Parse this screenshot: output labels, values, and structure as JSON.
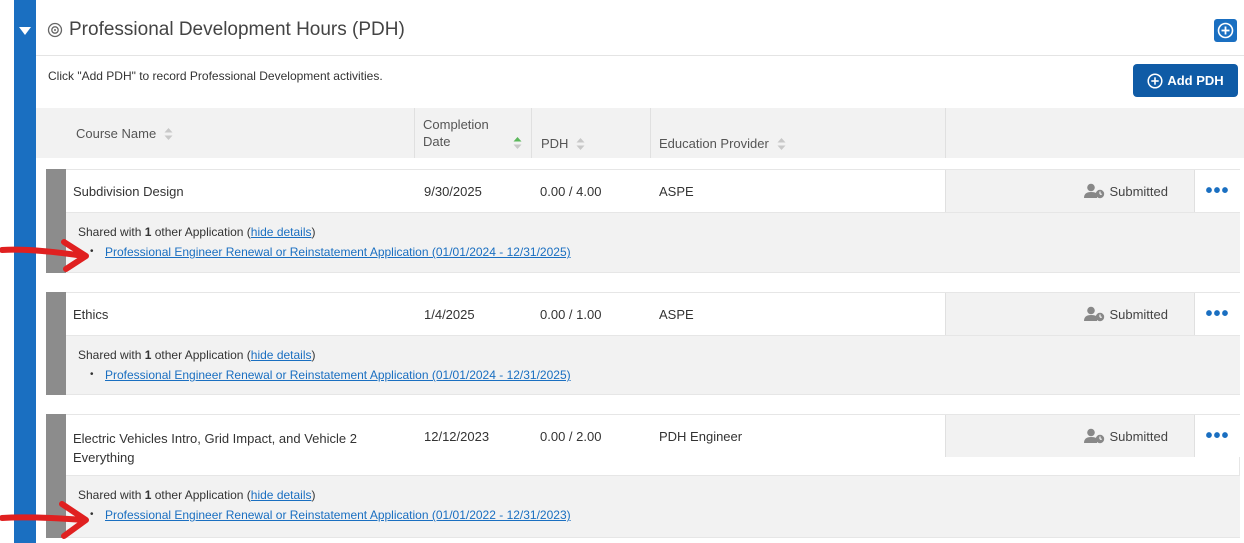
{
  "section": {
    "title": "Professional Development Hours (PDH)",
    "instructions": "Click \"Add PDH\" to record Professional Development activities.",
    "add_button_label": "Add PDH"
  },
  "table": {
    "columns": {
      "course_name": "Course Name",
      "completion_date_line1": "Completion",
      "completion_date_line2": "Date",
      "pdh": "PDH",
      "education_provider": "Education Provider"
    }
  },
  "records": [
    {
      "course_line1": "Subdivision Design",
      "course_line2": "",
      "completion_date": "9/30/2025",
      "pdh": "0.00 / 4.00",
      "provider": "ASPE",
      "status": "Submitted",
      "shared_prefix": "Shared with ",
      "shared_count": "1",
      "shared_suffix": " other Application (",
      "hide_details": "hide details",
      "shared_close": ")",
      "application_link": "Professional Engineer Renewal or Reinstatement Application (01/01/2024 - 12/31/2025)"
    },
    {
      "course_line1": "Ethics",
      "course_line2": "",
      "completion_date": "1/4/2025",
      "pdh": "0.00 / 1.00",
      "provider": "ASPE",
      "status": "Submitted",
      "shared_prefix": "Shared with ",
      "shared_count": "1",
      "shared_suffix": " other Application (",
      "hide_details": "hide details",
      "shared_close": ")",
      "application_link": "Professional Engineer Renewal or Reinstatement Application (01/01/2024 - 12/31/2025)"
    },
    {
      "course_line1": "Electric Vehicles Intro, Grid Impact, and Vehicle 2",
      "course_line2": "Everything",
      "completion_date": "12/12/2023",
      "pdh": "0.00 / 2.00",
      "provider": "PDH Engineer",
      "status": "Submitted",
      "shared_prefix": "Shared with ",
      "shared_count": "1",
      "shared_suffix": " other Application (",
      "hide_details": "hide details",
      "shared_close": ")",
      "application_link": "Professional Engineer Renewal or Reinstatement Application (01/01/2022 - 12/31/2023)"
    }
  ],
  "colors": {
    "accent": "#1a6fc1",
    "button": "#0f5ba6",
    "stripe": "#8c8c8c",
    "annotation_arrow": "#e02020"
  },
  "icons": {
    "collapse": "caret-down-icon",
    "section": "target-icon",
    "add": "plus-circle-icon",
    "sort": "sort-icon",
    "status": "user-clock-icon",
    "more": "ellipsis-icon"
  }
}
